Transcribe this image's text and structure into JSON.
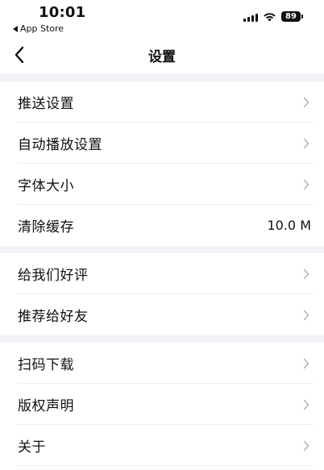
{
  "status_bar": {
    "time": "10:01",
    "back_app": "App Store",
    "battery": "89"
  },
  "nav": {
    "title": "设置"
  },
  "sections": [
    {
      "items": [
        {
          "label": "推送设置"
        },
        {
          "label": "自动播放设置"
        },
        {
          "label": "字体大小"
        },
        {
          "label": "清除缓存",
          "value": "10.0 M"
        }
      ]
    },
    {
      "items": [
        {
          "label": "给我们好评"
        },
        {
          "label": "推荐给好友"
        }
      ]
    },
    {
      "items": [
        {
          "label": "扫码下载"
        },
        {
          "label": "版权声明"
        },
        {
          "label": "关于"
        }
      ]
    }
  ],
  "colors": {
    "section_gap": "#f1f1f6",
    "divider": "#ececec",
    "chevron": "#b5b5b5"
  }
}
